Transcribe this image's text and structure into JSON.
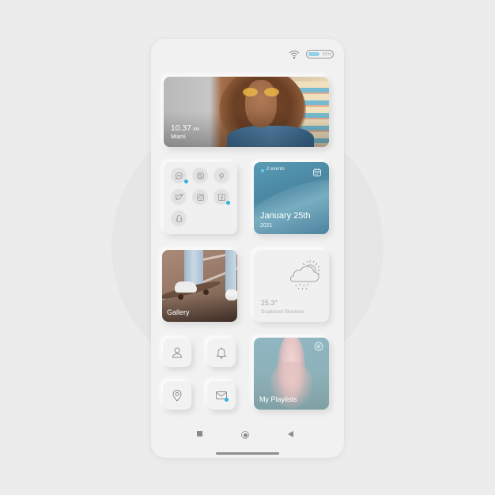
{
  "status_bar": {
    "wifi_icon": "wifi-icon",
    "battery_percent": "51%",
    "battery_level": 0.51
  },
  "hero_widget": {
    "time": "10.37",
    "ampm": "AM",
    "city": "Miami"
  },
  "social_widget": {
    "apps": [
      {
        "name": "messenger",
        "icon": "chat-bubble-icon",
        "notification": true
      },
      {
        "name": "skype",
        "icon": "skype-icon",
        "notification": false
      },
      {
        "name": "pinterest",
        "icon": "pinterest-icon",
        "notification": false
      },
      {
        "name": "twitter",
        "icon": "twitter-icon",
        "notification": false
      },
      {
        "name": "instagram",
        "icon": "instagram-icon",
        "notification": false
      },
      {
        "name": "facebook",
        "icon": "facebook-icon",
        "notification": true
      },
      {
        "name": "snapchat",
        "icon": "snapchat-icon",
        "notification": false
      }
    ]
  },
  "calendar_widget": {
    "events": "2 events",
    "date": "January 25th",
    "year": "2021",
    "icon": "calendar-icon"
  },
  "gallery_widget": {
    "label": "Gallery"
  },
  "weather_widget": {
    "temperature": "25.3°",
    "condition": "Scattered Showers",
    "icon": "cloud-sun-rain-icon"
  },
  "quick_actions": [
    {
      "name": "profile",
      "icon": "user-icon",
      "notification": false
    },
    {
      "name": "notifications",
      "icon": "bell-icon",
      "notification": false
    },
    {
      "name": "location",
      "icon": "map-pin-icon",
      "notification": false
    },
    {
      "name": "mail",
      "icon": "mail-icon",
      "notification": true
    }
  ],
  "playlist_widget": {
    "label": "My Playlists",
    "icon": "spotify-icon"
  },
  "nav_bar": {
    "recents": "square-icon",
    "home": "circle-icon",
    "back": "triangle-back-icon"
  },
  "colors": {
    "accent": "#2fb4e0",
    "background": "#ececec",
    "phone": "#f1f1f1",
    "battery_fill": "#8fd3e8"
  }
}
